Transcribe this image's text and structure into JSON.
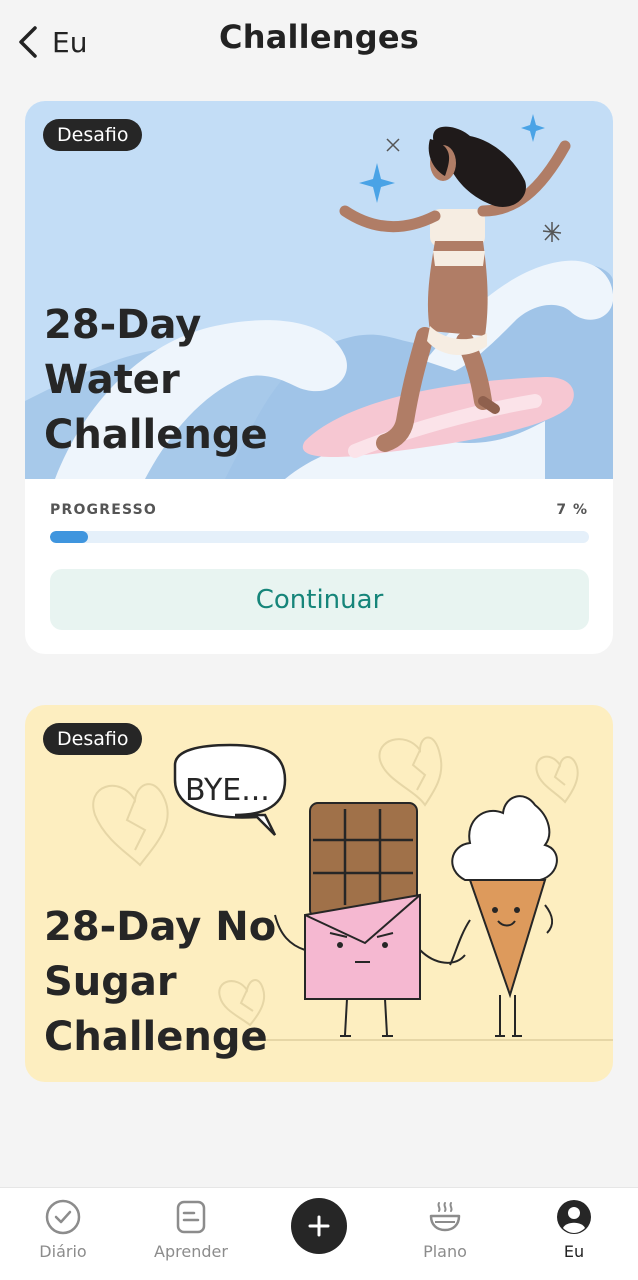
{
  "header": {
    "back_label": "Eu",
    "title": "Challenges"
  },
  "challenges": [
    {
      "badge": "Desafio",
      "title": "28-Day\nWater\nChallenge",
      "progress_label": "PROGRESSO",
      "progress_value": "7 %",
      "progress_fraction": 0.07,
      "button_label": "Continuar"
    },
    {
      "badge": "Desafio",
      "title": "28-Day No\nSugar\nChallenge",
      "speech_bubble": "BYE..."
    }
  ],
  "bottom_nav": {
    "items": [
      {
        "label": "Diário",
        "icon": "check-circle-icon"
      },
      {
        "label": "Aprender",
        "icon": "document-icon"
      },
      {
        "label": "",
        "icon": "plus-icon"
      },
      {
        "label": "Plano",
        "icon": "bowl-icon"
      },
      {
        "label": "Eu",
        "icon": "user-icon"
      }
    ],
    "active": "Eu"
  },
  "colors": {
    "background": "#f4f4f4",
    "water_card_bg": "#c3ddf6",
    "sugar_card_bg": "#fdeec0",
    "progress_fill": "#3f95de",
    "progress_track": "#e5f0fa",
    "button_bg": "#e8f4f1",
    "button_text": "#16857a",
    "dark": "#262626"
  }
}
